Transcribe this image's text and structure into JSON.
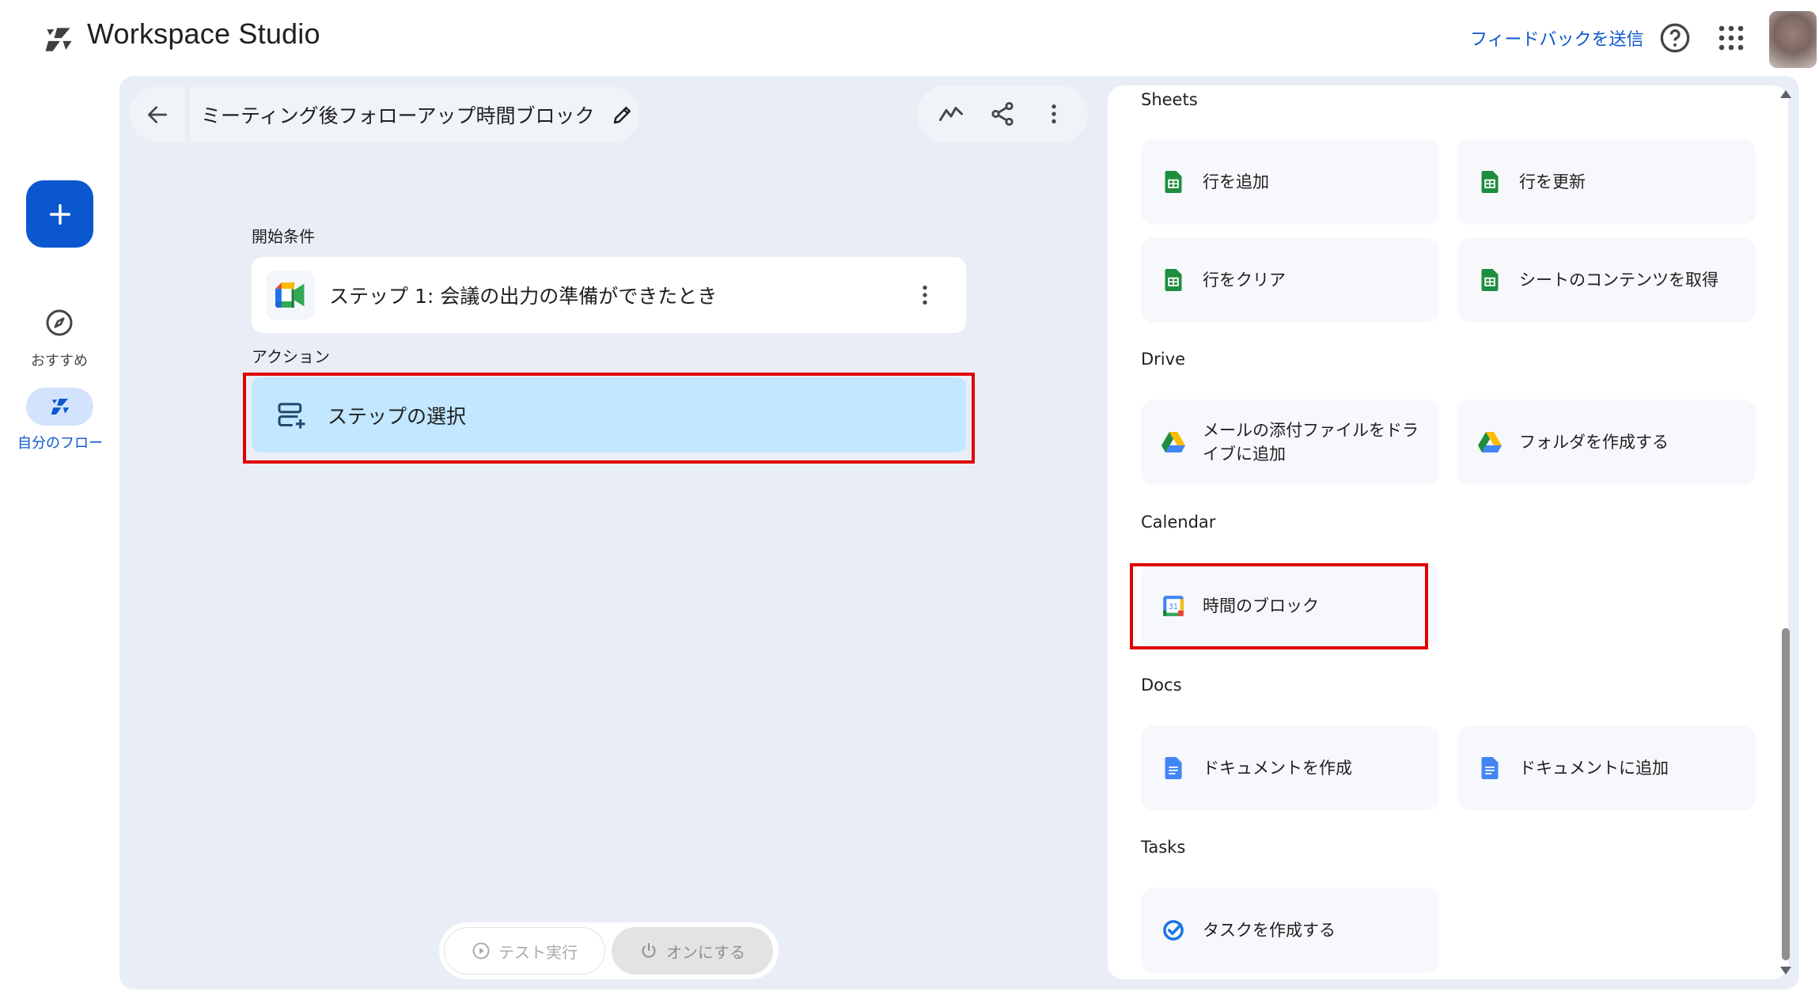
{
  "header": {
    "app_title": "Workspace Studio",
    "feedback_label": "フィードバックを送信",
    "help_icon": "help-circle-icon",
    "apps_icon": "grid-apps-icon"
  },
  "rail": {
    "create_label": "+",
    "recommend_label": "おすすめ",
    "my_flows_label": "自分のフロー"
  },
  "flow": {
    "title": "ミーティング後フォローアップ時間ブロック",
    "start_section_label": "開始条件",
    "step1_text": "ステップ 1: 会議の出力の準備ができたとき",
    "action_section_label": "アクション",
    "select_step_text": "ステップの選択"
  },
  "bottom": {
    "test_run_label": "テスト実行",
    "turn_on_label": "オンにする"
  },
  "panel": {
    "sections": [
      {
        "title": "Sheets",
        "items": [
          "行を追加",
          "行を更新",
          "行をクリア",
          "シートのコンテンツを取得"
        ]
      },
      {
        "title": "Drive",
        "items": [
          "メールの添付ファイルをドライブに追加",
          "フォルダを作成する"
        ]
      },
      {
        "title": "Calendar",
        "items": [
          "時間のブロック"
        ]
      },
      {
        "title": "Docs",
        "items": [
          "ドキュメントを作成",
          "ドキュメントに追加"
        ]
      },
      {
        "title": "Tasks",
        "items": [
          "タスクを作成する"
        ]
      }
    ]
  },
  "colors": {
    "accent": "#0b57d0",
    "canvas_bg": "#e9eef6",
    "selected_card": "#c2e7ff",
    "highlight": "#e00000",
    "sheets_green": "#1e8e3e",
    "docs_blue": "#4285f4"
  }
}
